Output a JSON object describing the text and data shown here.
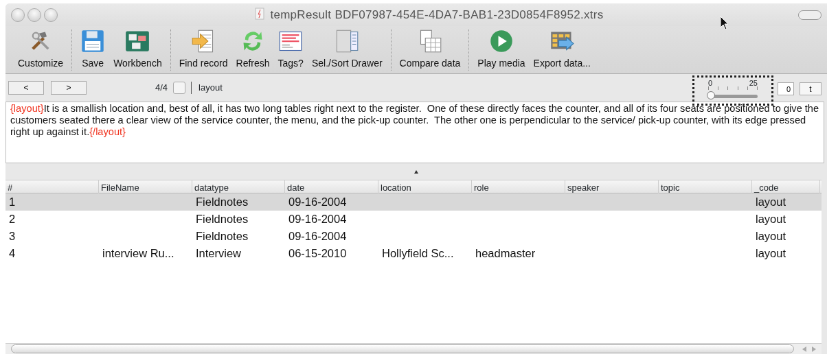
{
  "window": {
    "title": "tempResult BDF07987-454E-4DA7-BAB1-23D0854F8952.xtrs"
  },
  "toolbar": {
    "groups": [
      {
        "items": [
          {
            "label": "Customize"
          }
        ]
      },
      {
        "items": [
          {
            "label": "Save"
          },
          {
            "label": "Workbench"
          }
        ]
      },
      {
        "items": [
          {
            "label": "Find record"
          },
          {
            "label": "Refresh"
          },
          {
            "label": "Tags?"
          },
          {
            "label": "Sel./Sort Drawer"
          }
        ]
      },
      {
        "items": [
          {
            "label": "Compare data"
          }
        ]
      },
      {
        "items": [
          {
            "label": "Play media"
          },
          {
            "label": "Export data..."
          }
        ]
      }
    ]
  },
  "navigation": {
    "prev": "<",
    "next": ">",
    "position": "4/4",
    "checked": false,
    "code": "layout",
    "slider": {
      "min_label": "0",
      "max_label": "25",
      "level": 0
    },
    "value": "0",
    "button": "t"
  },
  "text_view": {
    "parts": [
      {
        "kind": "tag",
        "text": "{layout}"
      },
      {
        "kind": "body",
        "text": "It is a smallish location and, best of all, it has two long tables right next to the register.  One of these directly faces the counter, and all of its four seats are positioned to give the customers seated there a clear view of the service counter, the menu, and the pick-up counter.  The other one is perpendicular to the service/ pick-up counter, with its edge pressed right up against it."
      },
      {
        "kind": "tag",
        "text": "{/layout}"
      }
    ]
  },
  "table": {
    "columns": [
      "#",
      "FileName",
      "datatype",
      "date",
      "location",
      "role",
      "speaker",
      "topic",
      "_code"
    ],
    "rows": [
      {
        "selected": true,
        "cells": [
          "1",
          "",
          "Fieldnotes",
          "09-16-2004",
          "",
          "",
          "",
          "",
          "layout"
        ]
      },
      {
        "selected": false,
        "cells": [
          "2",
          "",
          "Fieldnotes",
          "09-16-2004",
          "",
          "",
          "",
          "",
          "layout"
        ]
      },
      {
        "selected": false,
        "cells": [
          "3",
          "",
          "Fieldnotes",
          "09-16-2004",
          "",
          "",
          "",
          "",
          "layout"
        ]
      },
      {
        "selected": false,
        "cells": [
          "4",
          "interview Ru...",
          "Interview",
          "06-15-2010",
          "Hollyfield Sc...",
          "headmaster",
          "",
          "",
          "layout"
        ]
      }
    ]
  }
}
